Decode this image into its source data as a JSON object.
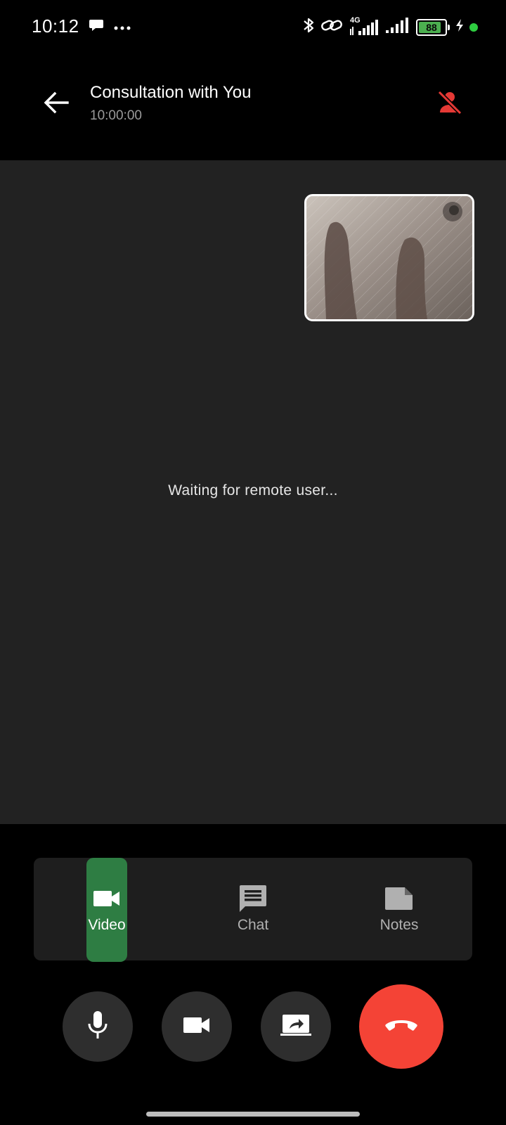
{
  "status_bar": {
    "time": "10:12",
    "battery_level": "88",
    "battery_fraction": 0.88,
    "network_label": "4G",
    "icons": [
      "chat-bubble-icon",
      "more-dots-icon",
      "bluetooth-icon",
      "link-icon",
      "signal-4g-icon",
      "signal-icon",
      "battery-icon",
      "charging-icon",
      "green-dot-icon"
    ]
  },
  "header": {
    "title": "Consultation with You",
    "subtitle": "10:00:00",
    "back_icon": "arrow-left-icon",
    "remote_status_icon": "person-off-icon",
    "remote_status_color": "#e53935"
  },
  "video_area": {
    "waiting_text": "Waiting for remote user...",
    "background": "#222222"
  },
  "tabs": [
    {
      "label": "Video",
      "icon": "videocam-icon",
      "active": true,
      "active_color": "#2e7d43"
    },
    {
      "label": "Chat",
      "icon": "chat-icon",
      "active": false
    },
    {
      "label": "Notes",
      "icon": "note-icon",
      "active": false
    }
  ],
  "controls": {
    "mic_icon": "mic-icon",
    "camera_icon": "videocam-icon",
    "share_icon": "screen-share-icon",
    "end_call_icon": "call-end-icon",
    "end_call_color": "#f44336"
  }
}
